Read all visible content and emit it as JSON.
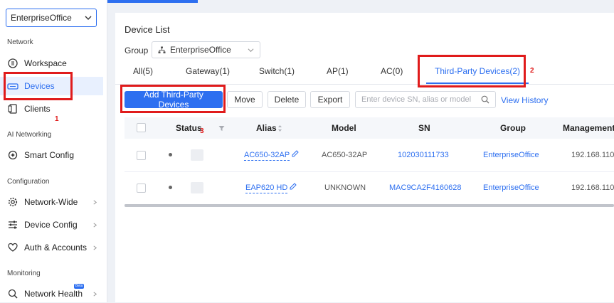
{
  "sidebar": {
    "site": "EnterpriseOffice",
    "sections": {
      "network": "Network",
      "ai": "AI Networking",
      "config": "Configuration",
      "monitoring": "Monitoring"
    },
    "items": {
      "workspace": "Workspace",
      "devices": "Devices",
      "clients": "Clients",
      "smart_config": "Smart Config",
      "network_wide": "Network-Wide",
      "device_config": "Device Config",
      "auth_accounts": "Auth & Accounts",
      "network_health": "Network Health"
    },
    "beta_badge": "Beta"
  },
  "annotations": {
    "one": "1",
    "two": "2",
    "three": "3"
  },
  "page": {
    "title": "Device List",
    "group_label": "Group",
    "group_value": "EnterpriseOffice"
  },
  "tabs": {
    "all": "All(5)",
    "gateway": "Gateway(1)",
    "switch": "Switch(1)",
    "ap": "AP(1)",
    "ac": "AC(0)",
    "third_party": "Third-Party Devices(2)"
  },
  "toolbar": {
    "add": "Add Third-Party Devices",
    "move": "Move",
    "delete": "Delete",
    "export": "Export",
    "search_placeholder": "Enter device SN, alias or model",
    "view_history": "View History"
  },
  "table": {
    "headers": {
      "status": "Status",
      "alias": "Alias",
      "model": "Model",
      "sn": "SN",
      "group": "Group",
      "mgmt": "Management I"
    },
    "rows": [
      {
        "alias": "AC650-32AP",
        "model": "AC650-32AP",
        "sn": "102030111733",
        "group": "EnterpriseOffice",
        "mgmt": "192.168.110"
      },
      {
        "alias": "EAP620 HD",
        "model": "UNKNOWN",
        "sn": "MAC9CA2F4160628",
        "group": "EnterpriseOffice",
        "mgmt": "192.168.110"
      }
    ]
  },
  "colors": {
    "accent": "#2d6ff0",
    "annotation": "#e01b1b",
    "active_bg": "#e8f0fe"
  }
}
